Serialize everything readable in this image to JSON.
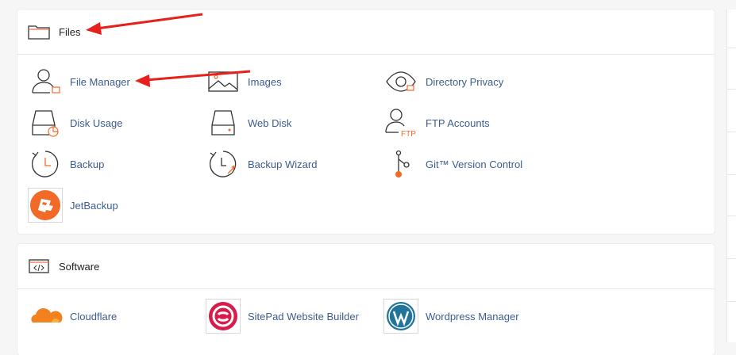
{
  "files": {
    "title": "Files",
    "items": [
      {
        "label": "File Manager",
        "icon": "file-manager-icon"
      },
      {
        "label": "Images",
        "icon": "images-icon"
      },
      {
        "label": "Directory Privacy",
        "icon": "directory-privacy-icon"
      },
      {
        "label": "Disk Usage",
        "icon": "disk-usage-icon"
      },
      {
        "label": "Web Disk",
        "icon": "web-disk-icon"
      },
      {
        "label": "FTP Accounts",
        "icon": "ftp-accounts-icon"
      },
      {
        "label": "Backup",
        "icon": "backup-icon"
      },
      {
        "label": "Backup Wizard",
        "icon": "backup-wizard-icon"
      },
      {
        "label": "Git™ Version Control",
        "icon": "git-icon"
      },
      {
        "label": "JetBackup",
        "icon": "jetbackup-icon"
      }
    ],
    "ftp_badge": "FTP"
  },
  "software": {
    "title": "Software",
    "items": [
      {
        "label": "Cloudflare",
        "icon": "cloudflare-icon"
      },
      {
        "label": "SitePad Website Builder",
        "icon": "sitepad-icon"
      },
      {
        "label": "Wordpress Manager",
        "icon": "wordpress-icon"
      }
    ]
  },
  "colors": {
    "link": "#3b5d8f",
    "accent_orange": "#f26a28",
    "annotation_arrow": "#e8201c",
    "sitepad": "#d81b4a",
    "wordpress": "#21759b"
  }
}
